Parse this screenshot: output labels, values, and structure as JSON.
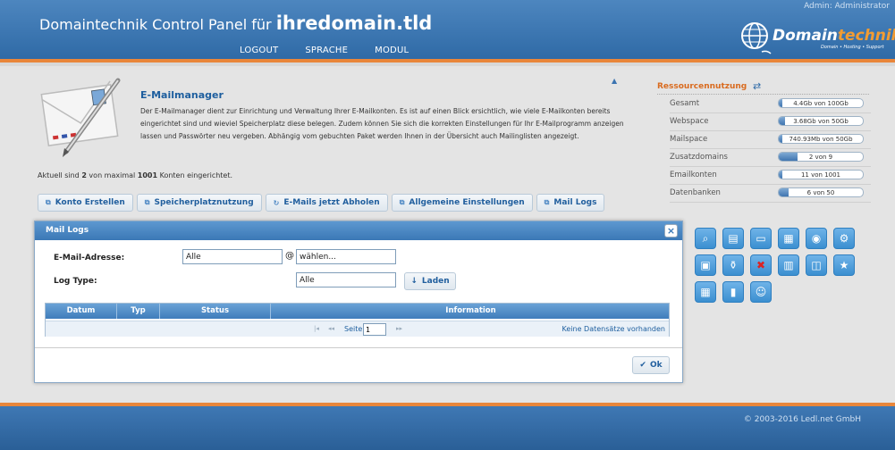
{
  "header": {
    "admin": "Admin: Administrator",
    "title_prefix": "Domaintechnik Control Panel für ",
    "title_domain": "ihredomain.tld",
    "nav": [
      "LOGOUT",
      "SPRACHE",
      "MODUL"
    ],
    "logo_main": "Domain",
    "logo_accent": "technik",
    "logo_sub": "Domain  •  Hosting  •  Support"
  },
  "module": {
    "title": "E-Mailmanager",
    "description": "Der E-Mailmanager dient zur Einrichtung und Verwaltung Ihrer E-Mailkonten. Es ist auf einen Blick ersichtlich, wie viele E-Mailkonten bereits eingerichtet sind und wieviel Speicherplatz diese belegen. Zudem können Sie sich die korrekten Einstellungen für Ihr E-Mailprogramm anzeigen lassen und Passwörter neu vergeben. Abhängig vom gebuchten Paket werden Ihnen in der Übersicht auch Mailinglisten angezeigt.",
    "count_prefix": "Aktuell sind ",
    "count_current": "2",
    "count_middle": " von maximal ",
    "count_max": "1001",
    "count_suffix": " Konten eingerichtet."
  },
  "tabs": [
    {
      "label": "Konto Erstellen",
      "icon": "link-icon"
    },
    {
      "label": "Speicherplatznutzung",
      "icon": "link-icon"
    },
    {
      "label": "E-Mails jetzt Abholen",
      "icon": "refresh-icon"
    },
    {
      "label": "Allgemeine Einstellungen",
      "icon": "link-icon"
    },
    {
      "label": "Mail Logs",
      "icon": "link-icon"
    }
  ],
  "resources": {
    "title": "Ressourcennutzung",
    "items": [
      {
        "label": "Gesamt",
        "value": "4.4Gb von 100Gb",
        "fraction": 0.044
      },
      {
        "label": "Webspace",
        "value": "3.68Gb von 50Gb",
        "fraction": 0.074
      },
      {
        "label": "Mailspace",
        "value": "740.93Mb von 50Gb",
        "fraction": 0.015
      },
      {
        "label": "Zusatzdomains",
        "value": "2 von 9",
        "fraction": 0.22
      },
      {
        "label": "Emailkonten",
        "value": "11 von 1001",
        "fraction": 0.011
      },
      {
        "label": "Datenbanken",
        "value": "6 von 50",
        "fraction": 0.12
      }
    ]
  },
  "modal": {
    "title": "Mail Logs",
    "close": "×",
    "email_label": "E-Mail-Adresse:",
    "email_value": "Alle",
    "at": "@",
    "domain_value": "wählen...",
    "logtype_label": "Log Type:",
    "logtype_value": "Alle",
    "load_label": "Laden",
    "columns": [
      "Datum",
      "Typ",
      "Status",
      "Information"
    ],
    "page_label": "Seite",
    "page_value": "1",
    "empty": "Keine Datensätze vorhanden",
    "ok_label": "Ok"
  },
  "footer": {
    "copyright": "© 2003-2016 Ledl.net GmbH"
  }
}
